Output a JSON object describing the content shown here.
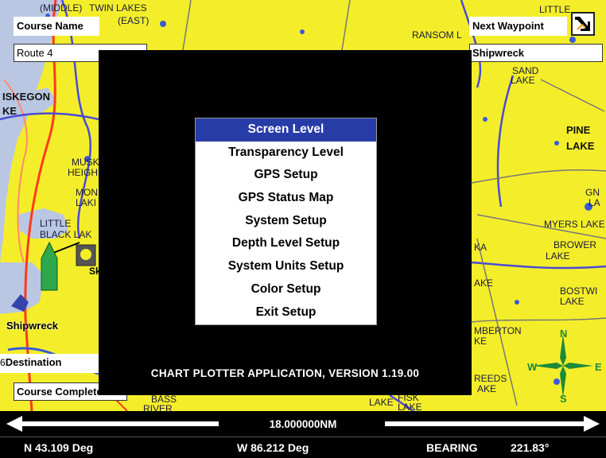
{
  "map": {
    "labels": {
      "middle": "(MIDDLE)",
      "twin_lakes": "TWIN LAKES",
      "east": "(EAST)",
      "ransom": "RANSOM L",
      "little_top": "LITTLE",
      "sand": "SAND",
      "lake_sand": "LAKE",
      "muskegon": "ISKEGON",
      "ke": "KE",
      "pine": "PINE",
      "pine_lake": "LAKE",
      "musk": "MUSK",
      "heigh": "HEIGH",
      "mon": "MON",
      "laki": "LAKI",
      "little": "LITTLE",
      "black_lake": "BLACK LAK",
      "gn": "GN",
      "la": "LA",
      "myers_lake": "MYERS LAKE",
      "ka": "KA",
      "brower": "BROWER",
      "brower_lake": "LAKE",
      "ake": "AKE",
      "bostwi": "BOSTWI",
      "bostwi_lake": "LAKE",
      "mberton": "MBERTON",
      "ke2": "KE",
      "bass": "BASS",
      "river": "RIVER",
      "lake_bottom": "LAKE",
      "fisk": "FISK",
      "fisk_lake": "LAKE",
      "reeds": "REEDS",
      "ake2": "AKE"
    },
    "skull_label": "Skul",
    "compass": {
      "n": "N",
      "s": "S",
      "e": "E",
      "w": "W"
    }
  },
  "panels": {
    "course_name_label": "Course Name",
    "course_name_value": "Route 4",
    "next_waypoint_label": "Next Waypoint",
    "next_waypoint_value": "Shipwreck",
    "shipwreck_tag": "Shipwreck",
    "destination_label": "Destination",
    "destination_prefix": "6",
    "course_complete_value": "Course Complete"
  },
  "menu": {
    "items": [
      "Screen Level",
      "Transparency Level",
      "GPS Setup",
      "GPS Status Map",
      "System Setup",
      "Depth Level Setup",
      "System Units Setup",
      "Color Setup",
      "Exit Setup"
    ],
    "selected_index": 0
  },
  "version_text": "CHART PLOTTER APPLICATION, VERSION 1.19.00",
  "scale": {
    "text": "18.000000NM"
  },
  "status": {
    "lat": "N  43.109 Deg",
    "lon": "W  86.212 Deg",
    "bearing_label": "BEARING",
    "bearing_value": "221.83°"
  },
  "colors": {
    "land": "#f4ee2a",
    "water": "#b9c7e3",
    "selection": "#283ca8",
    "boat": "#2ea84a"
  }
}
